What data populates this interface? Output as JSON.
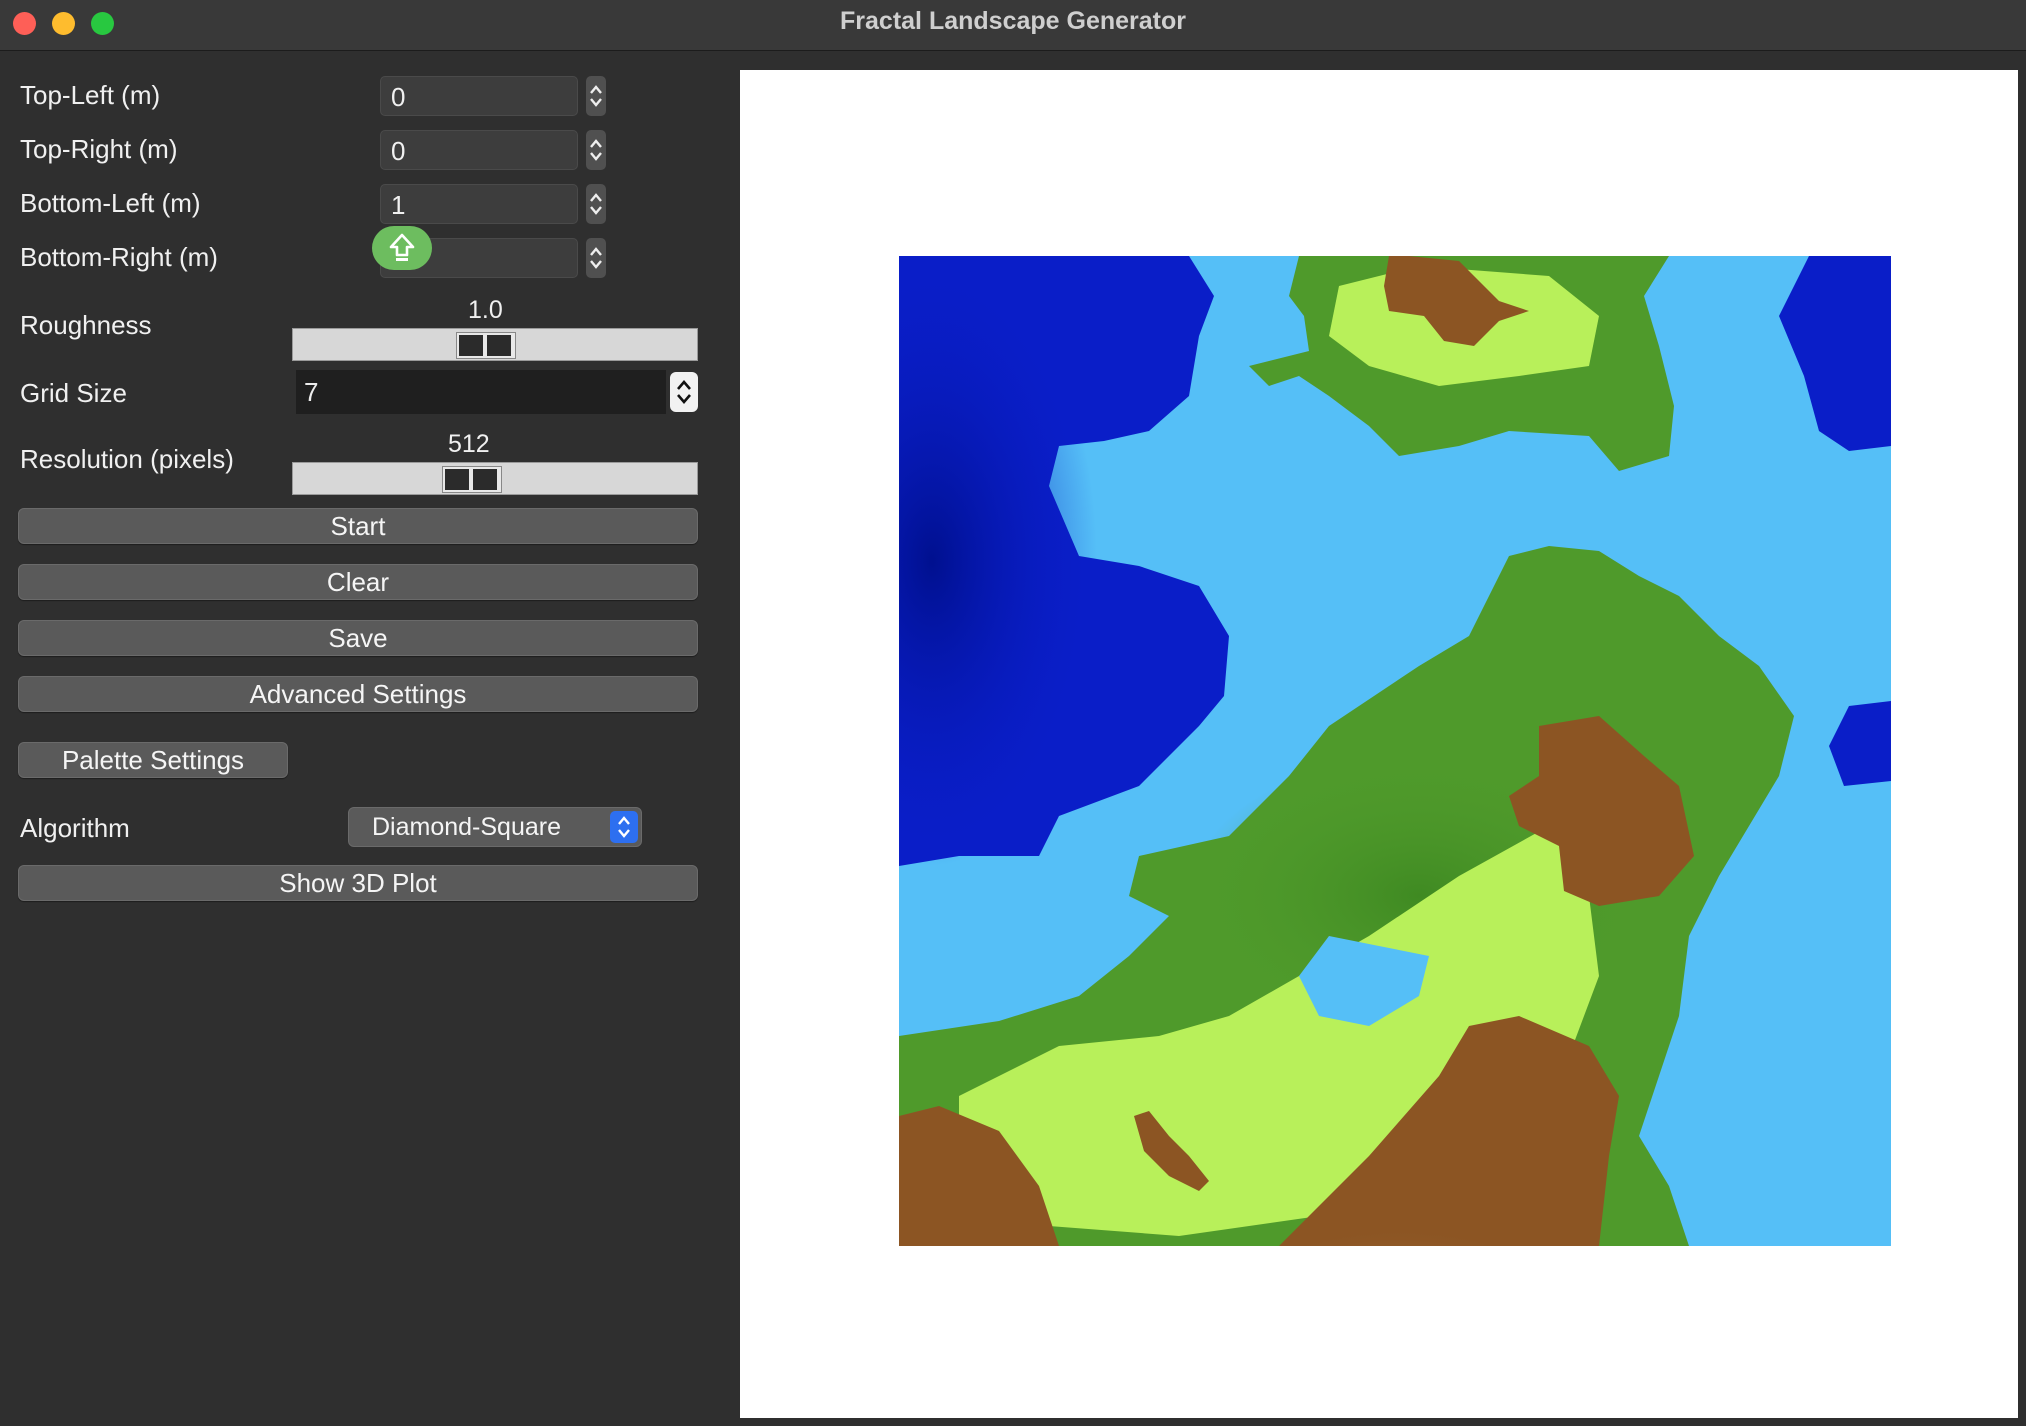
{
  "window": {
    "title": "Fractal Landscape Generator"
  },
  "corners": {
    "top_left": {
      "label": "Top-Left (m)",
      "value": "0"
    },
    "top_right": {
      "label": "Top-Right (m)",
      "value": "0"
    },
    "bottom_left": {
      "label": "Bottom-Left (m)",
      "value": "1"
    },
    "bottom_right": {
      "label": "Bottom-Right (m)",
      "value": ""
    }
  },
  "roughness": {
    "label": "Roughness",
    "value": "1.0",
    "fraction": 0.47
  },
  "grid_size": {
    "label": "Grid Size",
    "value": "7"
  },
  "resolution": {
    "label": "Resolution (pixels)",
    "value": "512",
    "fraction": 0.43
  },
  "buttons": {
    "start": "Start",
    "clear": "Clear",
    "save": "Save",
    "advanced": "Advanced Settings",
    "palette": "Palette Settings",
    "show3d": "Show 3D Plot"
  },
  "algorithm": {
    "label": "Algorithm",
    "selected": "Diamond-Square"
  },
  "palette": {
    "deep_water": "#0a1ec8",
    "shallow_water": "#55bff7",
    "lowland": "#4f9a2b",
    "highland": "#b8f05a",
    "mountain": "#8c5523",
    "peak": "#d8b892"
  }
}
